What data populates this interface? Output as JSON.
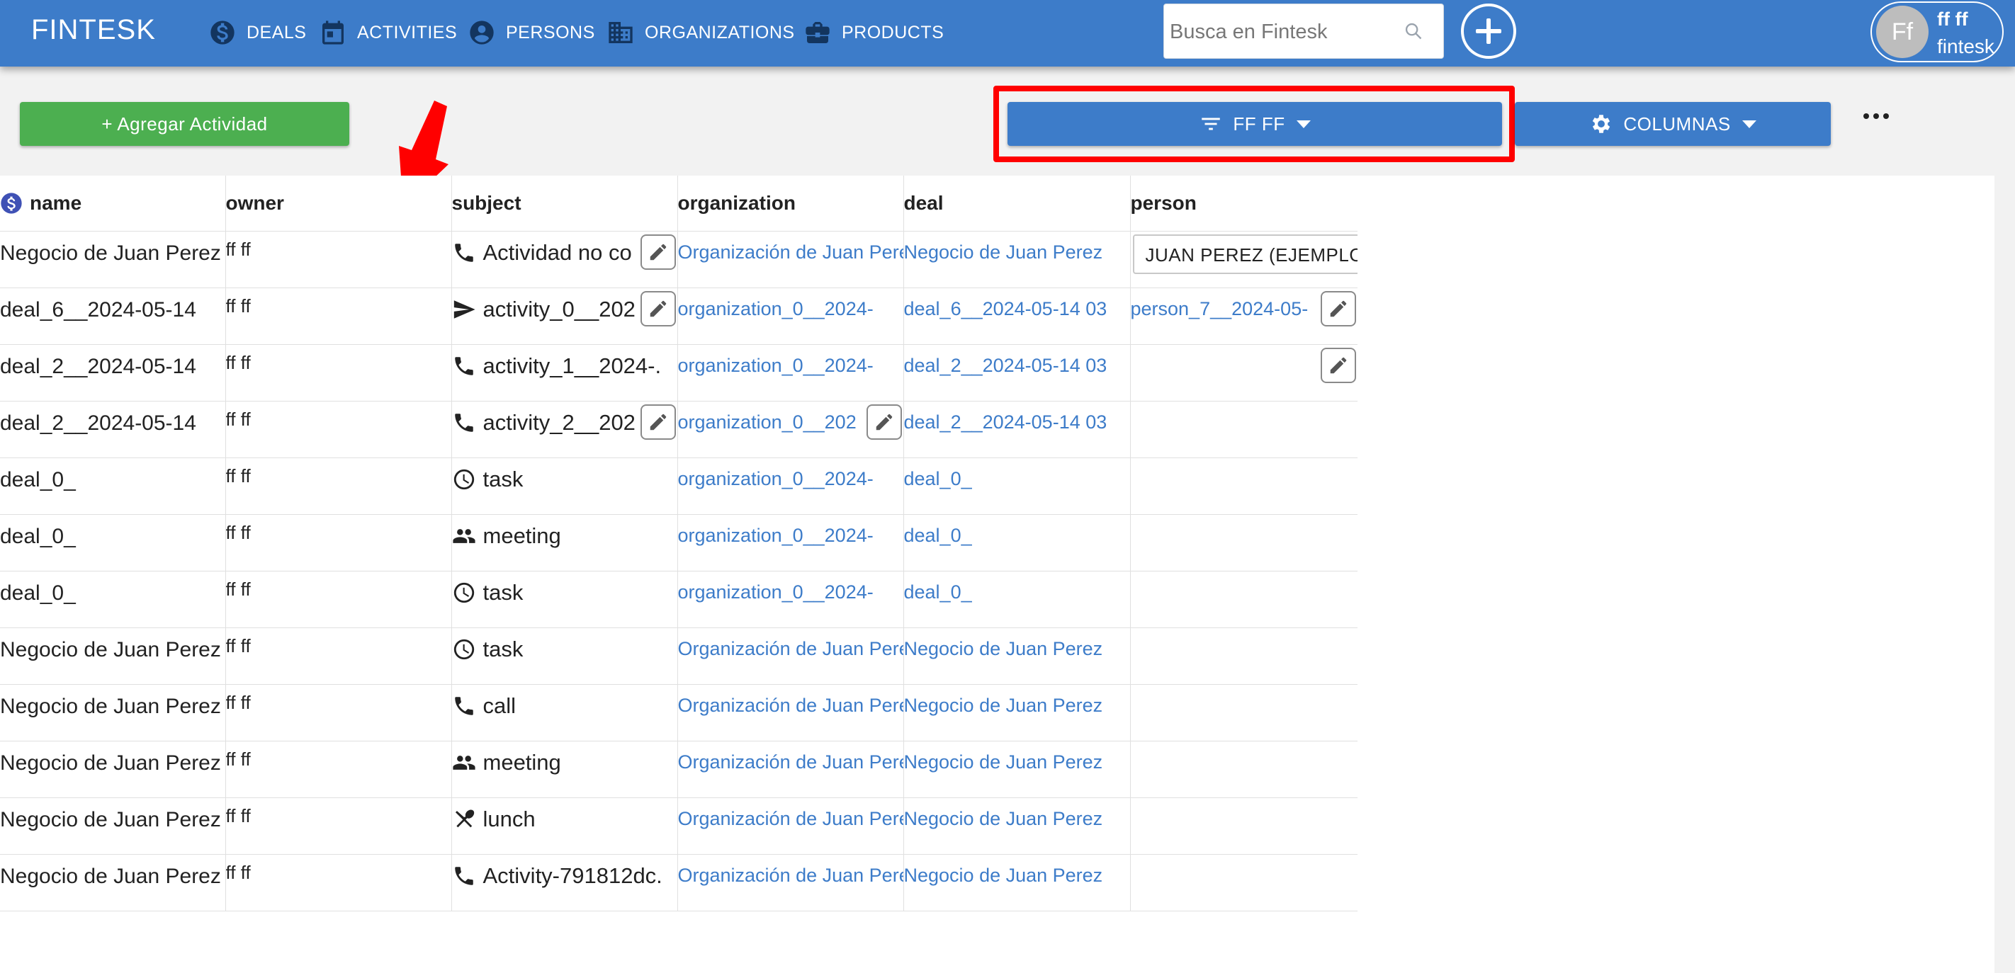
{
  "app": {
    "brand": "FINTESK"
  },
  "nav": [
    {
      "label": "DEALS",
      "icon": "dollar-icon"
    },
    {
      "label": "ACTIVITIES",
      "icon": "calendar-icon"
    },
    {
      "label": "PERSONS",
      "icon": "person-icon"
    },
    {
      "label": "ORGANIZATIONS",
      "icon": "building-icon"
    },
    {
      "label": "PRODUCTS",
      "icon": "briefcase-icon"
    }
  ],
  "search": {
    "placeholder": "Busca en Fintesk"
  },
  "user": {
    "initials": "Ff",
    "name": "ff ff",
    "org": "fintesk"
  },
  "toolbar": {
    "add_label": "+ Agregar Actividad",
    "filter_label": "FF FF",
    "columns_label": "COLUMNAS"
  },
  "colors": {
    "primary": "#3d7cc9",
    "add": "#4caf50",
    "highlight": "#ff0000",
    "link": "#3d7cc9"
  },
  "table": {
    "headers": [
      "name",
      "owner",
      "subject",
      "organization",
      "deal",
      "person"
    ],
    "rows": [
      {
        "name": "Negocio de Juan Perez",
        "owner": "ff ff",
        "subject_icon": "phone-icon",
        "subject": "Actividad no co",
        "organization": "Organización de Juan Perez",
        "deal": "Negocio de Juan Perez",
        "person": "JUAN PEREZ (EJEMPLO)"
      },
      {
        "name": "deal_6__2024-05-14",
        "owner": "ff ff",
        "subject_icon": "send-icon",
        "subject": "activity_0__202",
        "organization": "organization_0__2024-",
        "deal": "deal_6__2024-05-14 03",
        "person": "person_7__2024-05-"
      },
      {
        "name": "deal_2__2024-05-14",
        "owner": "ff ff",
        "subject_icon": "phone-icon",
        "subject": "activity_1__2024-.",
        "organization": "organization_0__2024-",
        "deal": "deal_2__2024-05-14 03",
        "person": ""
      },
      {
        "name": "deal_2__2024-05-14",
        "owner": "ff ff",
        "subject_icon": "phone-icon",
        "subject": "activity_2__202",
        "organization": "organization_0__202",
        "deal": "deal_2__2024-05-14 03",
        "person": ""
      },
      {
        "name": "deal_0_",
        "owner": "ff ff",
        "subject_icon": "clock-icon",
        "subject": "task",
        "organization": "organization_0__2024-",
        "deal": "deal_0_",
        "person": ""
      },
      {
        "name": "deal_0_",
        "owner": "ff ff",
        "subject_icon": "people-icon",
        "subject": "meeting",
        "organization": "organization_0__2024-",
        "deal": "deal_0_",
        "person": ""
      },
      {
        "name": "deal_0_",
        "owner": "ff ff",
        "subject_icon": "clock-icon",
        "subject": "task",
        "organization": "organization_0__2024-",
        "deal": "deal_0_",
        "person": ""
      },
      {
        "name": "Negocio de Juan Perez",
        "owner": "ff ff",
        "subject_icon": "clock-icon",
        "subject": "task",
        "organization": "Organización de Juan Perez",
        "deal": "Negocio de Juan Perez",
        "person": ""
      },
      {
        "name": "Negocio de Juan Perez",
        "owner": "ff ff",
        "subject_icon": "phone-icon",
        "subject": "call",
        "organization": "Organización de Juan Perez",
        "deal": "Negocio de Juan Perez",
        "person": ""
      },
      {
        "name": "Negocio de Juan Perez",
        "owner": "ff ff",
        "subject_icon": "people-icon",
        "subject": "meeting",
        "organization": "Organización de Juan Perez",
        "deal": "Negocio de Juan Perez",
        "person": ""
      },
      {
        "name": "Negocio de Juan Perez",
        "owner": "ff ff",
        "subject_icon": "utensils-icon",
        "subject": "lunch",
        "organization": "Organización de Juan Perez",
        "deal": "Negocio de Juan Perez",
        "person": ""
      },
      {
        "name": "Negocio de Juan Perez",
        "owner": "ff ff",
        "subject_icon": "phone-icon",
        "subject": "Activity-791812dc.",
        "organization": "Organización de Juan Perez",
        "deal": "Negocio de Juan Perez",
        "person": ""
      }
    ]
  }
}
